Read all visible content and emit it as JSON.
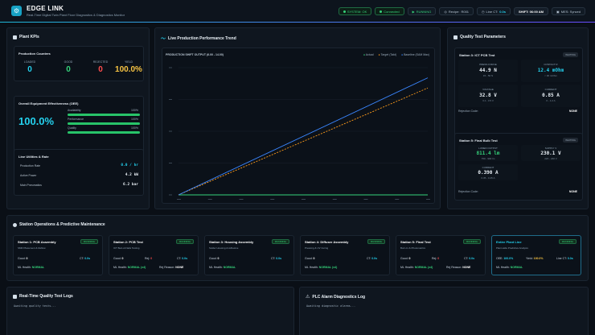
{
  "header": {
    "title": "EDGE LINK",
    "subtitle": "Real-Time Digital Twin Plant Floor Diagnostics & Diagnostics Monitor",
    "status": {
      "system": "SYSTEM: OK",
      "connection": "Connected",
      "running": "RUNNING",
      "recipe_label": "Recipe:",
      "recipe_value": "R001",
      "line_ct_label": "Line CT:",
      "line_ct_value": "0.0s",
      "shift": "SHIFT: 06:00 AM",
      "mes": "MES: Synced"
    },
    "accent": "#24d1ee"
  },
  "plant_kpis": {
    "title": "Plant KPIs",
    "counters_title": "Production Counters",
    "counters": [
      {
        "label": "LOADED",
        "value": "0",
        "color": "#24d1ee"
      },
      {
        "label": "GOOD",
        "value": "0",
        "color": "#35d27a"
      },
      {
        "label": "REJECTED",
        "value": "0",
        "color": "#ff4d4d"
      },
      {
        "label": "YIELD",
        "value": "100.0%",
        "color": "#f6c343"
      }
    ],
    "oee_title": "Overall Equipment Effectiveness (OEE)",
    "oee_value": "100.0%",
    "oee_parts": [
      {
        "label": "Availability",
        "value": "100%",
        "fraction": 1.0
      },
      {
        "label": "Performance",
        "value": "100%",
        "fraction": 1.0
      },
      {
        "label": "Quality",
        "value": "100%",
        "fraction": 1.0
      }
    ],
    "utilities_title": "Line Utilities & Rate",
    "utilities": [
      {
        "label": "Production Rate",
        "value": "0.0 / hr"
      },
      {
        "label": "Active Power",
        "value": "4.2 kW"
      },
      {
        "label": "Main Pneumatics",
        "value": "6.2 bar"
      }
    ]
  },
  "trend": {
    "title": "Live Production Performance Trend",
    "chart_title": "PRODUCTION SHIFT OUTPUT (6.00 - 14.00)",
    "legend": [
      "Actual",
      "Target (Takt)",
      "Baseline (SAM Max)"
    ]
  },
  "chart_data": {
    "type": "line",
    "title": "PRODUCTION SHIFT OUTPUT (6.00 - 14.00)",
    "x": [
      0,
      1
    ],
    "series": [
      {
        "name": "Actual",
        "values": [
          0,
          0
        ],
        "color": "#35d27a"
      },
      {
        "name": "Target (Takt)",
        "values": [
          0,
          0.84
        ],
        "color": "#ff9b1a"
      },
      {
        "name": "Baseline (SAM Max)",
        "values": [
          0,
          0.92
        ],
        "color": "#3a86ff"
      }
    ],
    "ylim": [
      0,
      1
    ],
    "grid": true,
    "legend_position": "top-right"
  },
  "quality": {
    "title": "Quality Test Parameters",
    "station3": {
      "title": "Station 3: ICT PCB Test",
      "status": "WAITING",
      "params": [
        {
          "label": "PRESS FORCE",
          "value": "44.9 N",
          "limit": "15 - 50 N",
          "highlight": false
        },
        {
          "label": "CONTACT R",
          "value": "12.4 mOhm",
          "limit": "< 30 mOhm",
          "highlight": true
        },
        {
          "label": "VOLTAGE",
          "value": "32.8 V",
          "limit": "3.1 - 3.5 V",
          "highlight": false
        },
        {
          "label": "CURRENT",
          "value": "0.85 A",
          "limit": "0 - 1.2 A",
          "highlight": false
        }
      ],
      "reject_label": "Rejection Code:",
      "reject_value": "NONE"
    },
    "station5": {
      "title": "Station 5: Final Bulb Test",
      "status": "WAITING",
      "params": [
        {
          "label": "LUMEN OUTPUT",
          "value": "811.4 lm",
          "limit": "750 - 900 lm",
          "highlight": true
        },
        {
          "label": "SUPPLY V",
          "value": "230.1 V",
          "limit": "220 - 240 V",
          "highlight": false
        },
        {
          "label": "CURRENT",
          "value": "0.390 A",
          "limit": "0.35 - 0.45 A",
          "highlight": false
        }
      ],
      "reject_label": "Rejection Code:",
      "reject_value": "NONE"
    }
  },
  "stations": {
    "title": "Station Operations & Predictive Maintenance",
    "items": [
      {
        "name": "Station 1: PCB Assembly",
        "desc": "SMD Placement & Reflow",
        "status": "RUNNING",
        "good_label": "Good:",
        "good": "0",
        "ct_label": "CT:",
        "ct": "0.0s",
        "ml_label": "ML Health:",
        "ml": "NORMAL"
      },
      {
        "name": "Station 2: PCB Test",
        "desc": "ICT Bed-of-Nails Testing",
        "status": "RUNNING",
        "good_label": "Good:",
        "good": "0",
        "rej_label": "Rej:",
        "rej": "0",
        "ct_label": "CT:",
        "ct": "0.0s",
        "ml_label": "ML Health:",
        "ml": "NORMAL (x4)",
        "reason_label": "Rej Reason:",
        "reason": "NONE"
      },
      {
        "name": "Station 3: Housing Assembly",
        "desc": "Solder Housing & Adhesive",
        "status": "RUNNING",
        "good_label": "Good:",
        "good": "0",
        "ct_label": "CT:",
        "ct": "0.0s",
        "ml_label": "ML Health:",
        "ml": "NORMAL"
      },
      {
        "name": "Station 4: Diffuser Assembly",
        "desc": "Pressing & UV Curing",
        "status": "RUNNING",
        "good_label": "Good:",
        "good": "0",
        "ct_label": "CT:",
        "ct": "0.0s",
        "ml_label": "ML Health:",
        "ml": "NORMAL (x4)"
      },
      {
        "name": "Station 5: Final Test",
        "desc": "Burn-In & Photometrics",
        "status": "RUNNING",
        "good_label": "Good:",
        "good": "0",
        "rej_label": "Rej:",
        "rej": "0",
        "ct_label": "CT:",
        "ct": "0.0s",
        "ml_label": "ML Health:",
        "ml": "NORMAL (x4)",
        "reason_label": "Rej Reason:",
        "reason": "NONE"
      },
      {
        "name": "Entire Plant Line",
        "desc": "Plant-wide Predictive Analysis",
        "status": "RUNNING",
        "oee_label": "OEE:",
        "oee": "100.0%",
        "yield_label": "Yield:",
        "yield": "100.0%",
        "ct_label": "Line CT:",
        "ct": "0.0s",
        "ml_label": "ML Health:",
        "ml": "NORMAL"
      }
    ]
  },
  "logs": {
    "quality_title": "Real-Time Quality Test Logs",
    "quality_text": "Awaiting quality tests...",
    "plc_title": "PLC Alarm Diagnostics Log",
    "plc_text": "Awaiting diagnostic alarms..."
  }
}
